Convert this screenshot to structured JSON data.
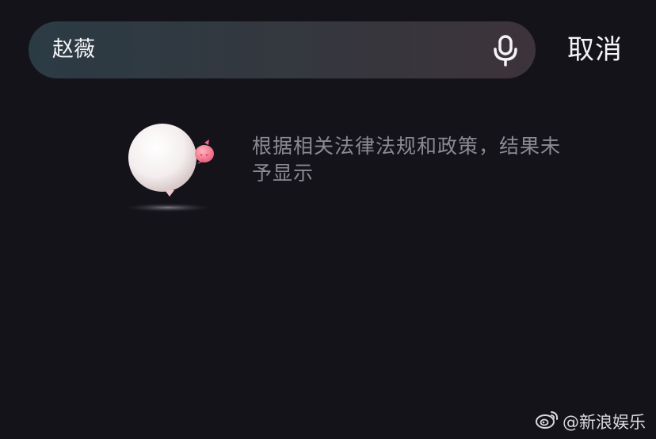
{
  "search": {
    "value": "赵薇",
    "mic_icon": "microphone-icon",
    "cancel_label": "取消"
  },
  "result": {
    "illustration": "balloon-mascot-illustration",
    "message": "根据相关法律法规和政策，结果未予显示"
  },
  "watermark": {
    "logo": "weibo-logo-icon",
    "text": "@新浪娱乐"
  }
}
